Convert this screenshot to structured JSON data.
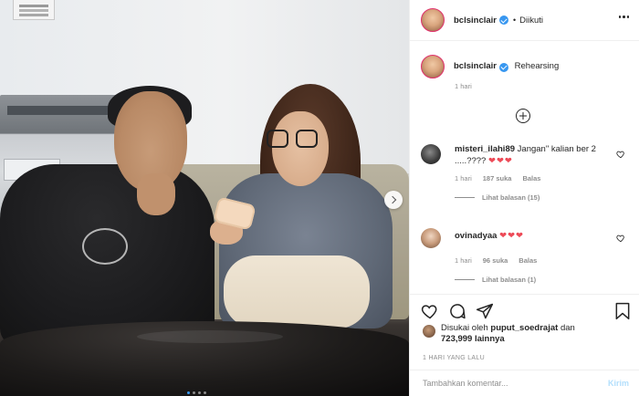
{
  "header": {
    "username": "bclsinclair",
    "separator": "•",
    "follow_state": "Diikuti"
  },
  "caption": {
    "username": "bclsinclair",
    "text": "Rehearsing",
    "time": "1 hari"
  },
  "comments": [
    {
      "username": "misteri_ilahi89",
      "text": "Jangan\" kalian ber 2 .....????",
      "hearts": "❤❤❤",
      "time": "1 hari",
      "likes": "187 suka",
      "reply": "Balas",
      "view_replies": "Lihat balasan (15)"
    },
    {
      "username": "ovinadyaa",
      "text": "",
      "hearts": "❤❤❤",
      "time": "1 hari",
      "likes": "96 suka",
      "reply": "Balas",
      "view_replies": "Lihat balasan (1)"
    }
  ],
  "likes": {
    "prefix": "Disukai oleh",
    "user": "puput_soedrajat",
    "connector": "dan",
    "count": "723,999",
    "suffix": "lainnya"
  },
  "post_time": "1 HARI YANG LALU",
  "composer": {
    "placeholder": "Tambahkan komentar...",
    "send_label": "Kirim"
  },
  "carousel": {
    "total": 4,
    "active_index": 1
  },
  "colors": {
    "verified": "#3897f0",
    "heart": "#ed4956",
    "send_disabled": "#b2dffc",
    "muted": "#8e8e8e"
  },
  "icons": {
    "like": "heart-outline-icon",
    "comment": "speech-bubble-icon",
    "share": "paper-plane-icon",
    "save": "bookmark-icon",
    "more": "more-dots-icon",
    "next": "chevron-right-icon",
    "add": "plus-circle-icon"
  }
}
